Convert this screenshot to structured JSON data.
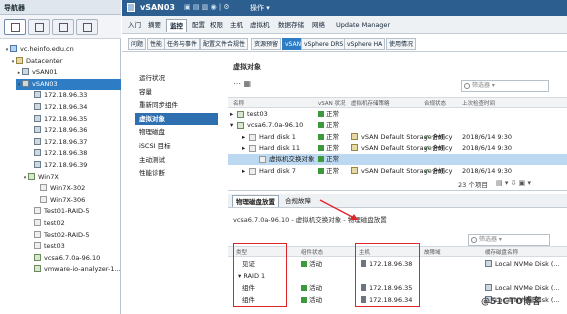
{
  "nav": {
    "title": "导航器",
    "tree": [
      {
        "label": "vc.heinfo.edu.cn",
        "icon": "vc"
      },
      {
        "label": "Datacenter",
        "icon": "dc"
      },
      {
        "label": "vSAN01",
        "icon": "host"
      },
      {
        "label": "vSAN03",
        "icon": "host"
      },
      {
        "label": "172.18.96.33",
        "icon": "host"
      },
      {
        "label": "172.18.96.34",
        "icon": "host"
      },
      {
        "label": "172.18.96.35",
        "icon": "host"
      },
      {
        "label": "172.18.96.36",
        "icon": "host"
      },
      {
        "label": "172.18.96.37",
        "icon": "host"
      },
      {
        "label": "172.18.96.38",
        "icon": "host"
      },
      {
        "label": "172.18.96.39",
        "icon": "host"
      },
      {
        "label": "Win7X",
        "icon": "vm"
      },
      {
        "label": "Win7X-302",
        "icon": "vmoff"
      },
      {
        "label": "Win7X-306",
        "icon": "vmoff"
      },
      {
        "label": "Test01-RAID-5",
        "icon": "vmoff"
      },
      {
        "label": "test02",
        "icon": "vmoff"
      },
      {
        "label": "Test02-RAID-5",
        "icon": "vmoff"
      },
      {
        "label": "test03",
        "icon": "vmoff"
      },
      {
        "label": "vcsa6.7.0a-96.10",
        "icon": "vm"
      },
      {
        "label": "vmware-io-analyzer-1...",
        "icon": "vm"
      }
    ]
  },
  "topbar": {
    "title": "vSAN03",
    "actions": "操作"
  },
  "tabs_primary": [
    "入门",
    "摘要",
    "监控",
    "配置",
    "权限",
    "主机",
    "虚拟机",
    "数据存储",
    "网络",
    "Update Manager"
  ],
  "tabs_secondary": [
    "问题",
    "性能",
    "任务与事件",
    "配置文件合规性",
    "资源预留",
    "vSAN",
    "vSphere DRS",
    "vSphere HA",
    "使用情况"
  ],
  "side_menu": [
    "运行状况",
    "容量",
    "重新同步组件",
    "虚拟对象",
    "物理磁盘",
    "iSCSI 目标",
    "主动测试",
    "性能诊断"
  ],
  "virtual_objects": {
    "title": "虚拟对象",
    "filter_placeholder": "筛选器",
    "columns": [
      "名称",
      "vSAN 状况",
      "虚拟机存储策略",
      "合规状态",
      "上次检查时间"
    ],
    "rows": [
      {
        "name": "test03",
        "status": "正常",
        "policy": "",
        "compliance": "",
        "checked": ""
      },
      {
        "name": "vcsa6.7.0a-96.10",
        "status": "正常",
        "policy": "",
        "compliance": "",
        "checked": ""
      },
      {
        "name": "Hard disk 1",
        "status": "正常",
        "policy": "vSAN Default Storage Policy",
        "compliance": "合规",
        "checked": "2018/6/14 9:30"
      },
      {
        "name": "Hard disk 11",
        "status": "正常",
        "policy": "vSAN Default Storage Policy",
        "compliance": "合规",
        "checked": "2018/6/14 9:30"
      },
      {
        "name": "虚拟机交换对象",
        "status": "正常",
        "policy": "",
        "compliance": "",
        "checked": ""
      },
      {
        "name": "Hard disk 7",
        "status": "正常",
        "policy": "vSAN Default Storage Policy",
        "compliance": "合规",
        "checked": "2018/6/14 9:30"
      }
    ],
    "count": "23 个项目"
  },
  "placement": {
    "tabs": [
      "物理磁盘放置",
      "合规故障"
    ],
    "subtitle": "vcsa6.7.0a-96.10 - 虚拟机交换对象 - 物理磁盘放置",
    "filter_placeholder": "筛选器",
    "columns": [
      "类型",
      "组件状态",
      "主机",
      "故障域",
      "缓存磁盘名称"
    ],
    "rows": [
      {
        "type": "见证",
        "state": "活动",
        "host": "172.18.96.38",
        "disk": "Local NVMe Disk (..."
      },
      {
        "type": "RAID 1",
        "state": "",
        "host": "",
        "disk": ""
      },
      {
        "type": "组件",
        "state": "活动",
        "host": "172.18.96.35",
        "disk": "Local NVMe Disk (..."
      },
      {
        "type": "组件",
        "state": "活动",
        "host": "172.18.96.34",
        "disk": "Local NVMe Disk (..."
      }
    ]
  },
  "watermark": "@51CTO博客",
  "colors": {
    "accent": "#2e7cc4",
    "highlight_box": "#e0242b",
    "topbar": "#2c5f8f"
  }
}
